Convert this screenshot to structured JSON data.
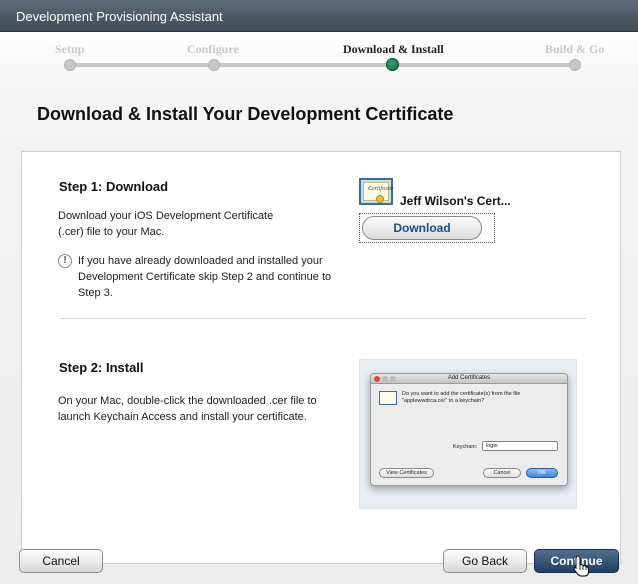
{
  "window": {
    "title": "Development Provisioning Assistant"
  },
  "progress": {
    "steps": [
      {
        "label": "Setup",
        "active": false
      },
      {
        "label": "Configure",
        "active": false
      },
      {
        "label": "Download & Install",
        "active": true
      },
      {
        "label": "Build & Go",
        "active": false
      }
    ]
  },
  "page": {
    "heading": "Download & Install Your Development Certificate"
  },
  "step1": {
    "title": "Step 1: Download",
    "description": "Download your iOS Development Certificate (.cer) file to your Mac.",
    "note": "If you have already downloaded and installed your Development Certificate skip Step 2 and continue to Step 3.",
    "note_icon": "!",
    "certificate_name": "Jeff Wilson's Cert...",
    "certificate_icon_text": "Certificate",
    "download_label": "Download"
  },
  "step2": {
    "title": "Step 2: Install",
    "description": "On your Mac, double-click the downloaded .cer file to launch Keychain Access and install your certificate.",
    "screenshot": {
      "window_title": "Add Certificates",
      "prompt": "Do you want to add the certificate(s) from the file \"applewwdrca.cer\" to a keychain?",
      "keychain_label": "Keychain:",
      "keychain_value": "login",
      "view_label": "View Certificates",
      "cancel_label": "Cancel",
      "ok_label": "OK"
    }
  },
  "footer": {
    "cancel_label": "Cancel",
    "back_label": "Go Back",
    "continue_label": "Continue"
  },
  "colors": {
    "titlebar": "#4a5866",
    "active_dot": "#0b6b3c",
    "primary_button": "#2a4a70",
    "link_text": "#1c4f86"
  }
}
